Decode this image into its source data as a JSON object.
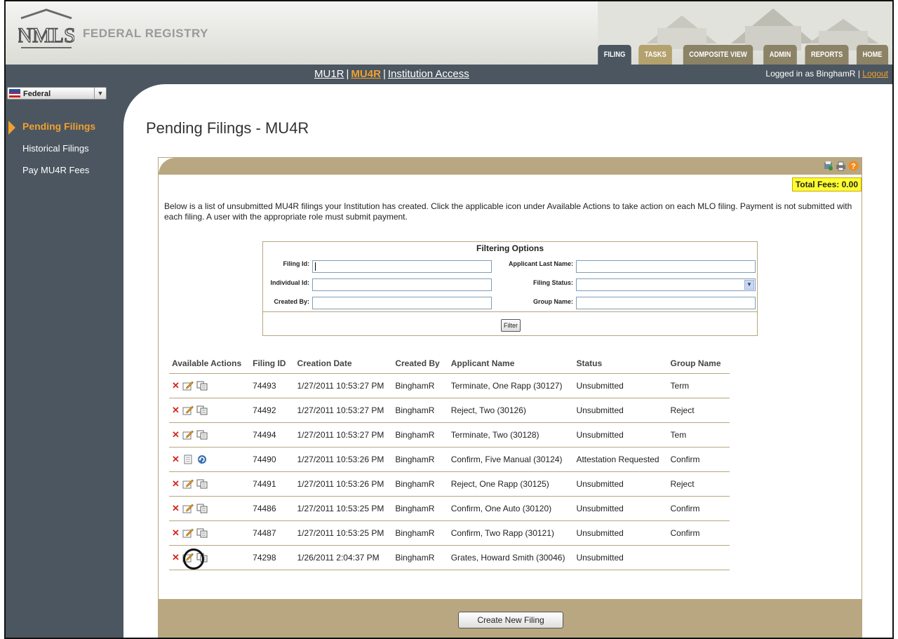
{
  "brand": {
    "name": "FEDERAL REGISTRY",
    "logo_text": "NMLS"
  },
  "tabs": [
    {
      "label": "FILING",
      "active": true
    },
    {
      "label": "TASKS",
      "active": false
    },
    {
      "label": "COMPOSITE VIEW",
      "active": false
    },
    {
      "label": "ADMIN",
      "active": false
    },
    {
      "label": "REPORTS",
      "active": false
    },
    {
      "label": "HOME",
      "active": false
    }
  ],
  "subnav": {
    "items": [
      "MU1R",
      "MU4R",
      "Institution Access"
    ],
    "active": "MU4R"
  },
  "login": {
    "text": "Logged in as BinghamR",
    "separator": "|",
    "logout": "Logout"
  },
  "sidebar": {
    "selector": "Federal",
    "items": [
      {
        "label": "Pending Filings",
        "active": true
      },
      {
        "label": "Historical Filings",
        "active": false
      },
      {
        "label": "Pay MU4R Fees",
        "active": false
      }
    ]
  },
  "page": {
    "title": "Pending Filings - MU4R",
    "total_fees": "Total Fees: 0.00",
    "intro": "Below is a list of unsubmitted MU4R filings your Institution has created. Click the applicable icon under Available Actions to take action on each MLO filing. Payment is not submitted with each filing. A user with the appropriate role must submit payment."
  },
  "filter": {
    "title": "Filtering Options",
    "labels": {
      "filing_id": "Filing Id:",
      "applicant_last_name": "Applicant Last Name:",
      "individual_id": "Individual Id:",
      "filing_status": "Filing Status:",
      "created_by": "Created By:",
      "group_name": "Group Name:"
    },
    "button": "Filter"
  },
  "table": {
    "headers": [
      "Available Actions",
      "Filing ID",
      "Creation Date",
      "Created By",
      "Applicant Name",
      "Status",
      "Group Name"
    ],
    "rows": [
      {
        "id": "74493",
        "date": "1/27/2011 10:53:27 PM",
        "by": "BinghamR",
        "name": "Terminate, One Rapp (30127)",
        "status": "Unsubmitted",
        "group": "Term",
        "actions": [
          "delete-icon",
          "edit-icon",
          "copy-icon"
        ]
      },
      {
        "id": "74492",
        "date": "1/27/2011 10:53:27 PM",
        "by": "BinghamR",
        "name": "Reject, Two (30126)",
        "status": "Unsubmitted",
        "group": "Reject",
        "actions": [
          "delete-icon",
          "edit-icon",
          "copy-icon"
        ]
      },
      {
        "id": "74494",
        "date": "1/27/2011 10:53:27 PM",
        "by": "BinghamR",
        "name": "Terminate, Two (30128)",
        "status": "Unsubmitted",
        "group": "Tem",
        "actions": [
          "delete-icon",
          "edit-icon",
          "copy-icon"
        ]
      },
      {
        "id": "74490",
        "date": "1/27/2011 10:53:26 PM",
        "by": "BinghamR",
        "name": "Confirm, Five Manual (30124)",
        "status": "Attestation Requested",
        "group": "Confirm",
        "actions": [
          "delete-icon",
          "view-icon",
          "refresh-icon"
        ]
      },
      {
        "id": "74491",
        "date": "1/27/2011 10:53:26 PM",
        "by": "BinghamR",
        "name": "Reject, One Rapp (30125)",
        "status": "Unsubmitted",
        "group": "Reject",
        "actions": [
          "delete-icon",
          "edit-icon",
          "copy-icon"
        ]
      },
      {
        "id": "74486",
        "date": "1/27/2011 10:53:25 PM",
        "by": "BinghamR",
        "name": "Confirm, One Auto (30120)",
        "status": "Unsubmitted",
        "group": "Confirm",
        "actions": [
          "delete-icon",
          "edit-icon",
          "copy-icon"
        ]
      },
      {
        "id": "74487",
        "date": "1/27/2011 10:53:25 PM",
        "by": "BinghamR",
        "name": "Confirm, Two Rapp (30121)",
        "status": "Unsubmitted",
        "group": "Confirm",
        "actions": [
          "delete-icon",
          "edit-icon",
          "copy-icon"
        ]
      },
      {
        "id": "74298",
        "date": "1/26/2011 2:04:37 PM",
        "by": "BinghamR",
        "name": "Grates, Howard Smith (30046)",
        "status": "Unsubmitted",
        "group": "",
        "actions": [
          "delete-icon",
          "edit-icon",
          "copy-icon"
        ]
      }
    ]
  },
  "create_button": "Create New Filing",
  "colors": {
    "accent": "#f0a030",
    "nav": "#4b5660",
    "panel": "#b8a780",
    "fees_bg": "#ffff30"
  }
}
